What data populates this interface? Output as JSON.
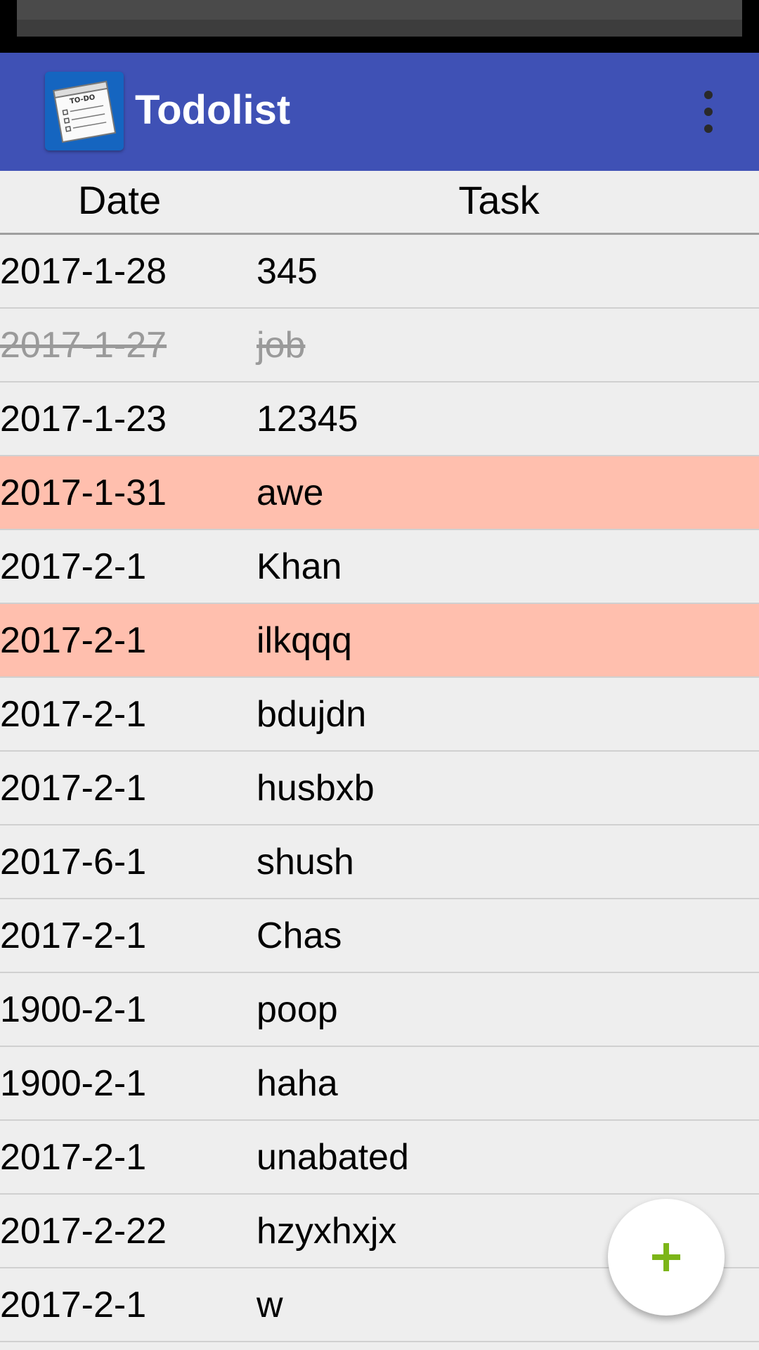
{
  "app": {
    "title": "Todolist"
  },
  "colors": {
    "app_bar": "#3f51b5",
    "highlight_row": "#ffbfae",
    "fab_plus": "#7cb518"
  },
  "icons": {
    "app_icon": "todo-notepad-icon",
    "overflow": "more-vert-icon",
    "fab": "plus-icon"
  },
  "header": {
    "date": "Date",
    "task": "Task"
  },
  "rows": [
    {
      "date": "2017-1-28",
      "task": "345",
      "state": "normal"
    },
    {
      "date": "2017-1-27",
      "task": "job",
      "state": "done"
    },
    {
      "date": "2017-1-23",
      "task": "12345",
      "state": "normal"
    },
    {
      "date": "2017-1-31",
      "task": "awe",
      "state": "highlighted"
    },
    {
      "date": "2017-2-1",
      "task": "Khan",
      "state": "normal"
    },
    {
      "date": "2017-2-1",
      "task": "ilkqqq",
      "state": "highlighted"
    },
    {
      "date": "2017-2-1",
      "task": "bdujdn",
      "state": "normal"
    },
    {
      "date": "2017-2-1",
      "task": "husbxb",
      "state": "normal"
    },
    {
      "date": "2017-6-1",
      "task": "shush",
      "state": "normal"
    },
    {
      "date": "2017-2-1",
      "task": "Chas",
      "state": "normal"
    },
    {
      "date": "1900-2-1",
      "task": "poop",
      "state": "normal"
    },
    {
      "date": "1900-2-1",
      "task": "haha",
      "state": "normal"
    },
    {
      "date": "2017-2-1",
      "task": "unabated",
      "state": "normal"
    },
    {
      "date": "2017-2-22",
      "task": "hzyxhxjx",
      "state": "normal"
    },
    {
      "date": "2017-2-1",
      "task": "w",
      "state": "normal"
    }
  ]
}
